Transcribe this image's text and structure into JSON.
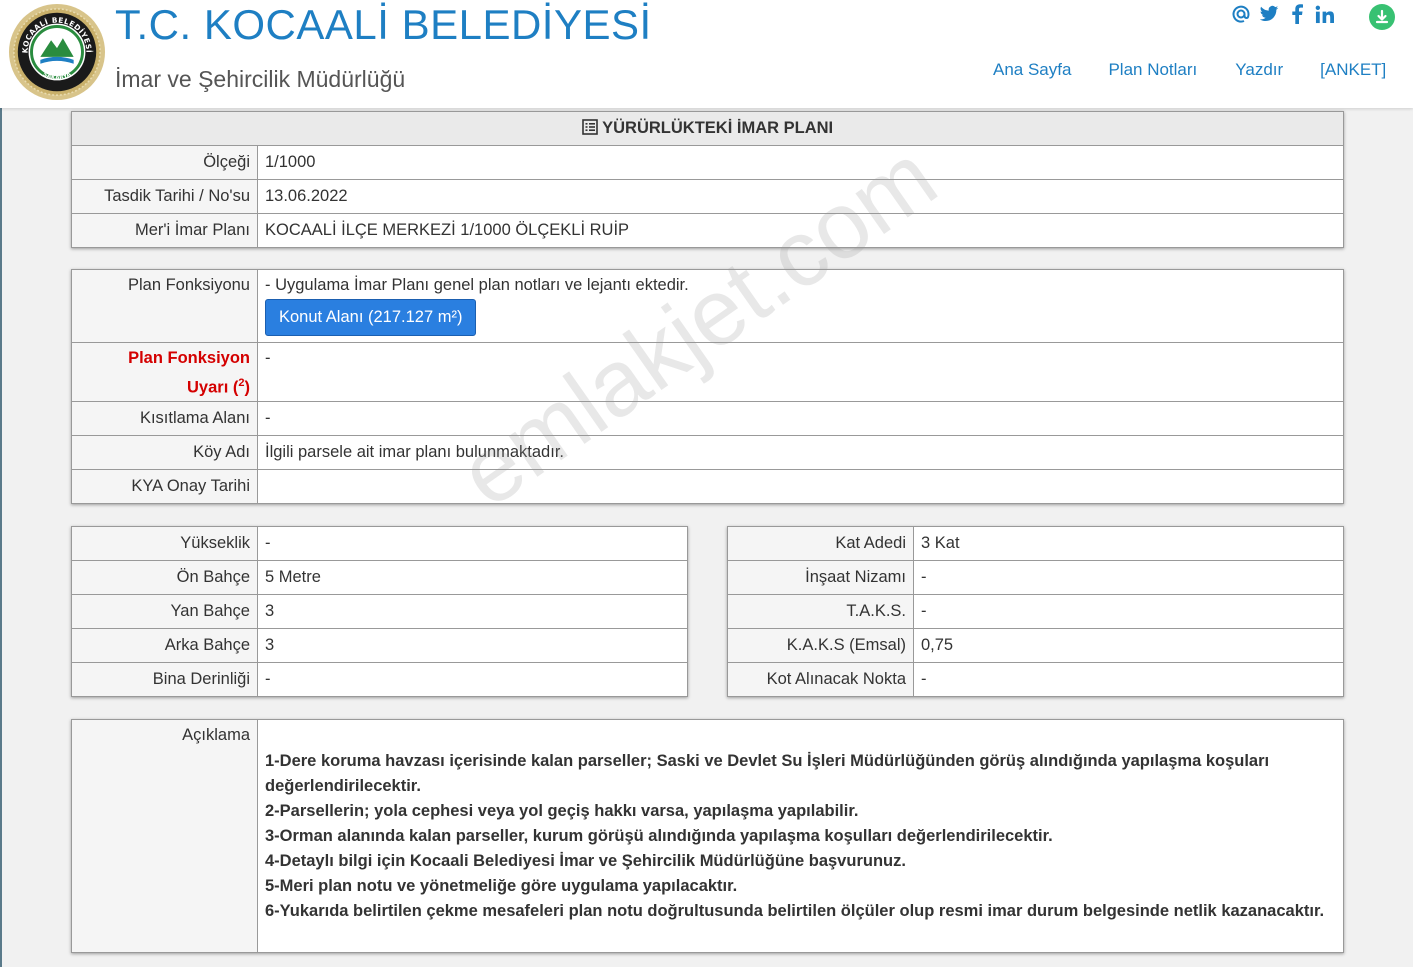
{
  "header": {
    "title": "T.C. KOCAALİ BELEDİYESİ",
    "subtitle": "İmar ve Şehircilik Müdürlüğü",
    "logo_text_top": "KOCAALİ BELEDİYESİ",
    "logo_text_bottom": "SAKARYA",
    "nav": [
      "Ana Sayfa",
      "Plan Notları",
      "Yazdır",
      "[ANKET]"
    ],
    "social_icons": [
      "at-icon",
      "twitter-icon",
      "facebook-icon",
      "linkedin-icon"
    ],
    "download_icon": "download-icon",
    "accent_color": "#1e7fc3"
  },
  "plan": {
    "heading": "YÜRÜRLÜKTEKİ İMAR PLANI",
    "rows": [
      {
        "label": "Ölçeği",
        "value": "1/1000"
      },
      {
        "label": "Tasdik Tarihi / No'su",
        "value": "13.06.2022"
      },
      {
        "label": "Mer'i İmar Planı",
        "value": "KOCAALİ İLÇE MERKEZİ 1/1000 ÖLÇEKLİ RUİP"
      }
    ]
  },
  "function": {
    "fonksiyon_label": "Plan Fonksiyonu",
    "fonksiyon_text": "- Uygulama İmar Planı genel plan notları ve lejantı ektedir.",
    "konut_button": "Konut Alanı (217.127 m²)",
    "uyari_label_1": "Plan Fonksiyon",
    "uyari_label_2": "Uyarı (",
    "uyari_sup": "2",
    "uyari_label_3": ")",
    "uyari_value": "-",
    "rows": [
      {
        "label": "Kısıtlama Alanı",
        "value": "-"
      },
      {
        "label": "Köy Adı",
        "value": "İlgili parsele ait imar planı bulunmaktadır."
      },
      {
        "label": "KYA Onay Tarihi",
        "value": ""
      }
    ]
  },
  "left_table": [
    {
      "label": "Yükseklik",
      "value": "-"
    },
    {
      "label": "Ön Bahçe",
      "value": "5 Metre"
    },
    {
      "label": "Yan Bahçe",
      "value": "3"
    },
    {
      "label": "Arka Bahçe",
      "value": "3"
    },
    {
      "label": "Bina Derinliği",
      "value": "-"
    }
  ],
  "right_table": [
    {
      "label": "Kat Adedi",
      "value": "3 Kat"
    },
    {
      "label": "İnşaat Nizamı",
      "value": "-"
    },
    {
      "label": "T.A.K.S.",
      "value": "-"
    },
    {
      "label": "K.A.K.S (Emsal)",
      "value": "0,75"
    },
    {
      "label": "Kot Alınacak Nokta",
      "value": "-"
    }
  ],
  "aciklama": {
    "label": "Açıklama",
    "notes": [
      "1-Dere koruma havzası içerisinde kalan parseller; Saski ve Devlet Su İşleri Müdürlüğünden görüş alındığında yapılaşma koşuları değerlendirilecektir.",
      "2-Parsellerin; yola cephesi veya yol geçiş hakkı varsa, yapılaşma yapılabilir.",
      "3-Orman alanında kalan parseller, kurum görüşü alındığında yapılaşma koşulları değerlendirilecektir.",
      "4-Detaylı bilgi için Kocaali Belediyesi İmar ve Şehircilik Müdürlüğüne başvurunuz.",
      "5-Meri plan notu ve yönetmeliğe göre uygulama yapılacaktır.",
      "6-Yukarıda belirtilen çekme mesafeleri plan notu doğrultusunda belirtilen ölçüler olup resmi imar durum belgesinde netlik kazanacaktır."
    ]
  },
  "watermark": "emlakjet.com"
}
